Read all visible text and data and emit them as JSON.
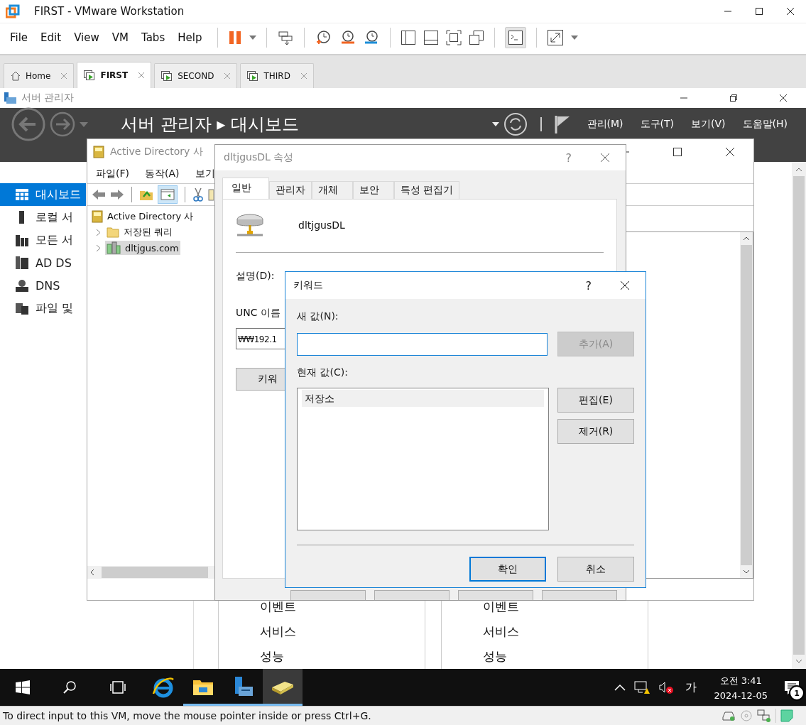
{
  "vmware": {
    "title": "FIRST - VMware Workstation",
    "menu": [
      "File",
      "Edit",
      "View",
      "VM",
      "Tabs",
      "Help"
    ],
    "tabs": [
      {
        "label": "Home",
        "kind": "home",
        "selected": false
      },
      {
        "label": "FIRST",
        "kind": "vm",
        "selected": true
      },
      {
        "label": "SECOND",
        "kind": "vm",
        "selected": false
      },
      {
        "label": "THIRD",
        "kind": "vm",
        "selected": false
      }
    ]
  },
  "server_manager": {
    "title": "서버 관리자",
    "heading": "서버 관리자 ▸ 대시보드",
    "menu": [
      "관리(M)",
      "도구(T)",
      "보기(V)",
      "도움말(H)"
    ],
    "sidebar": [
      {
        "label": "대시보드",
        "kind": "dashboard",
        "selected": true
      },
      {
        "label": "로컬 서",
        "kind": "local",
        "selected": false
      },
      {
        "label": "모든 서",
        "kind": "all",
        "selected": false
      },
      {
        "label": "AD DS",
        "kind": "adds",
        "selected": false
      },
      {
        "label": "DNS",
        "kind": "dns",
        "selected": false
      },
      {
        "label": "파일 및",
        "kind": "files",
        "selected": false
      }
    ],
    "tiles": [
      {
        "items": [
          "이벤트",
          "서비스",
          "성능"
        ]
      },
      {
        "items": [
          "이벤트",
          "서비스",
          "성능"
        ]
      }
    ]
  },
  "ad_window": {
    "title": "Active Directory 사",
    "menu": [
      "파일(F)",
      "동작(A)",
      "보기"
    ],
    "tree": [
      {
        "label": "Active Directory 사",
        "kind": "root",
        "selected": false,
        "children": [
          {
            "label": "저장된 쿼리",
            "kind": "folder",
            "selected": false
          },
          {
            "label": "dltjgus.com",
            "kind": "domain",
            "selected": true
          }
        ]
      }
    ]
  },
  "properties": {
    "title": "dltjgusDL 속성",
    "help": "?",
    "tabs": [
      {
        "label": "일반",
        "selected": true
      },
      {
        "label": "관리자",
        "selected": false
      },
      {
        "label": "개체",
        "selected": false
      },
      {
        "label": "보안",
        "selected": false
      },
      {
        "label": "특성 편집기",
        "selected": false
      }
    ],
    "name": "dltjgusDL",
    "description_label": "설명(D):",
    "unc_label": "UNC 이름",
    "unc_value": "₩₩192.1",
    "keywords_button": "키워"
  },
  "keyword_dialog": {
    "title": "키워드",
    "help": "?",
    "new_value_label": "새 값(N):",
    "add_button": {
      "label": "추가(A)",
      "disabled": true
    },
    "current_label": "현재 값(C):",
    "values": [
      {
        "label": "저장소",
        "selected": true
      }
    ],
    "edit_button": {
      "label": "편집(E)",
      "disabled": false
    },
    "remove_button": {
      "label": "제거(R)",
      "disabled": false
    },
    "ok_button": {
      "label": "확인",
      "default": true
    },
    "cancel_button": {
      "label": "취소",
      "default": false
    }
  },
  "taskbar": {
    "time": "오전 3:41",
    "date": "2024-12-05",
    "ime": "가",
    "notifications": "1"
  },
  "status_bar": "To direct input to this VM, move the mouse pointer inside or press Ctrl+G."
}
